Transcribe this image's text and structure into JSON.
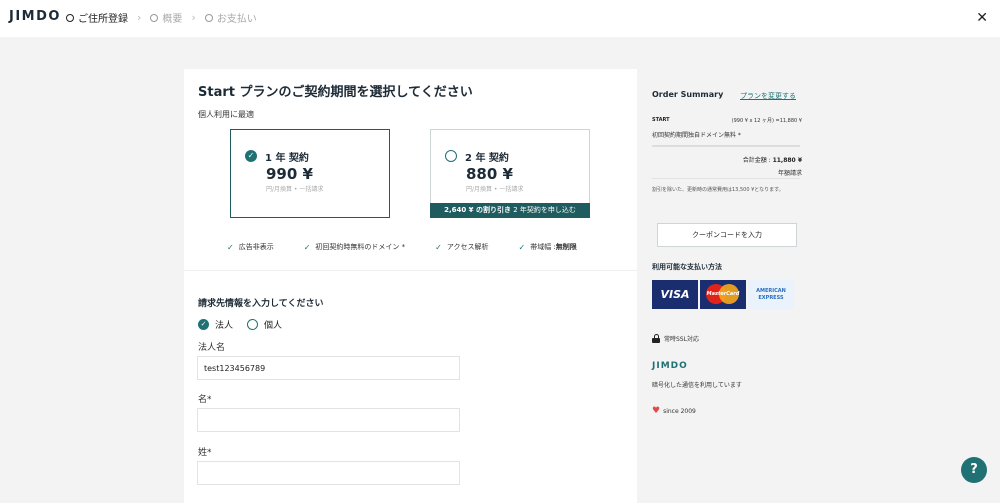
{
  "header": {
    "logo": "JIMDO",
    "steps": [
      {
        "label": "ご住所登録"
      },
      {
        "label": "概要"
      },
      {
        "label": "お支払い"
      }
    ],
    "close": "✕"
  },
  "main": {
    "title": "Start プランのご契約期間を選択してください",
    "subtitle": "個人利用に最適",
    "plans": [
      {
        "name": "1 年 契約",
        "price": "990 ¥",
        "note": "円/月換算 • 一括請求",
        "selected": true
      },
      {
        "name": "2 年 契約",
        "price": "880 ¥",
        "note": "円/月換算 • 一括請求",
        "banner_bold": "2,640 ¥ の割り引き",
        "banner_rest": " 2 年契約を申し込む",
        "selected": false
      }
    ],
    "features": [
      {
        "text": "広告非表示"
      },
      {
        "text": "初回契約時無料のドメイン *"
      },
      {
        "text": "アクセス解析"
      },
      {
        "label": "帯域幅 : ",
        "value": "無制限"
      }
    ],
    "billing": {
      "title": "請求先情報を入力してください",
      "type_options": [
        "法人",
        "個人"
      ],
      "company_label": "法人名",
      "company_value": "test123456789",
      "first_name_label": "名*",
      "first_name_value": "",
      "last_name_label": "姓*",
      "last_name_value": ""
    }
  },
  "summary": {
    "title": "Order Summary",
    "change_link": "プランを変更する",
    "plan_code": "START",
    "calc": "(990 ¥ x 12 ヶ月) =11,880 ¥",
    "domain": "初回契約期間独自ドメイン無料 *",
    "total_label": "合計金額 : ",
    "total_value": "11,880 ¥",
    "period": "年額請求",
    "note": "割引を除いた、更新時の通常費用は13,500 ¥となります。",
    "coupon": "クーポンコードを入力",
    "payment_title": "利用可能な支払い方法",
    "visa": "VISA",
    "mastercard": "MasterCard",
    "amex_1": "AMERICAN",
    "amex_2": "EXPRESS",
    "ssl": "常時SSL対応",
    "brand": "JIMDO",
    "encrypted": "暗号化した通信を利用しています",
    "since": "since 2009"
  },
  "help": "?",
  "colors": {
    "accent": "#1f7173",
    "dark": "#1f5c5f"
  }
}
